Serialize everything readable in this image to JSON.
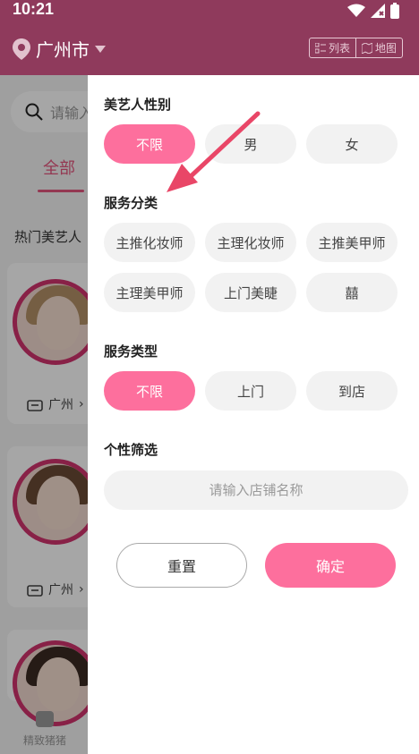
{
  "status_bar": {
    "time": "10:21"
  },
  "header": {
    "city": "广州市",
    "list_label": "列表",
    "map_label": "地图"
  },
  "background": {
    "search_placeholder": "请输入",
    "tab_all": "全部",
    "hot_label": "热门美艺人",
    "cards": [
      {
        "location": "广州"
      },
      {
        "location": "广州"
      }
    ],
    "nav_label": "精致猪猪"
  },
  "filter": {
    "gender": {
      "title": "美艺人性别",
      "options": [
        "不限",
        "男",
        "女"
      ],
      "selected": "不限"
    },
    "category": {
      "title": "服务分类",
      "options": [
        "主推化妆师",
        "主理化妆师",
        "主推美甲师",
        "主理美甲师",
        "上门美睫",
        "囍"
      ]
    },
    "service_type": {
      "title": "服务类型",
      "options": [
        "不限",
        "上门",
        "到店"
      ],
      "selected": "不限"
    },
    "personal": {
      "title": "个性筛选",
      "placeholder": "请输入店铺名称"
    },
    "reset_label": "重置",
    "confirm_label": "确定"
  },
  "colors": {
    "header": "#8f3a5c",
    "accent": "#fd6f9d",
    "chip": "#f2f2f2",
    "arrow": "#e94667"
  }
}
